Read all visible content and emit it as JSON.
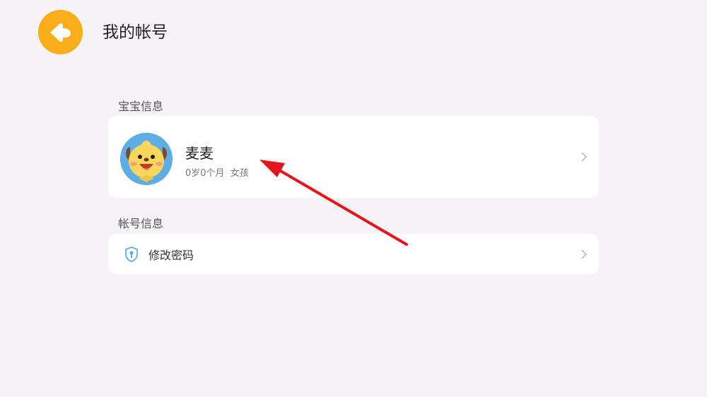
{
  "header": {
    "title": "我的帐号",
    "back_icon": "back-arrow-icon"
  },
  "baby_section": {
    "label": "宝宝信息",
    "name": "麦麦",
    "age": "0岁0个月",
    "gender": "女孩"
  },
  "account_section": {
    "label": "帐号信息",
    "change_password_label": "修改密码"
  },
  "colors": {
    "accent": "#f9ae1a",
    "background": "#f6f3f6",
    "annotation": "#e8141b"
  }
}
